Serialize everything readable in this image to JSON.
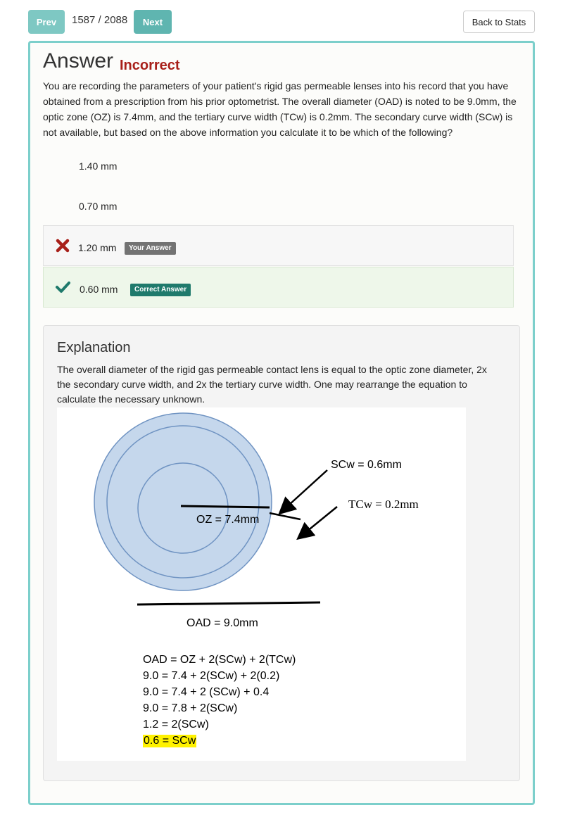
{
  "nav": {
    "prev_label": "Prev",
    "counter": "1587 / 2088",
    "next_label": "Next",
    "back_label": "Back to Stats"
  },
  "answer": {
    "heading": "Answer",
    "status": "Incorrect",
    "question": "You are recording the parameters of your patient's rigid gas permeable lenses into his record that you have obtained from a prescription from his prior optometrist. The overall diameter (OAD) is noted to be 9.0mm, the optic zone (OZ) is 7.4mm, and the tertiary curve width (TCw) is 0.2mm. The secondary curve width (SCw) is not available, but based on the above information you calculate it to be which of the following?",
    "choices": [
      {
        "label": "1.40 mm"
      },
      {
        "label": "0.70 mm"
      },
      {
        "label": "1.20 mm",
        "badge": "Your Answer"
      },
      {
        "label": "0.60 mm",
        "badge": "Correct Answer"
      }
    ]
  },
  "explanation": {
    "title": "Explanation",
    "text": "The overall diameter of the rigid gas permeable contact lens is equal to the optic zone diameter, 2x the secondary curve width, and 2x the tertiary curve width. One may rearrange the equation to calculate the necessary unknown.",
    "figure": {
      "scw_label": "SCw = 0.6mm",
      "tcw_label": "TCw = 0.2mm",
      "oz_label": "OZ = 7.4mm",
      "oad_label": "OAD = 9.0mm",
      "equations": [
        "OAD = OZ + 2(SCw) + 2(TCw)",
        "9.0 = 7.4 + 2(SCw) + 2(0.2)",
        "9.0 = 7.4 + 2 (SCw) + 0.4",
        "9.0 = 7.8 + 2(SCw)",
        "1.2 = 2(SCw)",
        "0.6 = SCw"
      ]
    }
  },
  "colors": {
    "accent": "#7ccfcb",
    "incorrect": "#a8201a",
    "correct": "#1f7a6c",
    "lens_fill": "#c5d7ec",
    "lens_stroke": "#6f93c2",
    "highlight": "#fff200"
  }
}
